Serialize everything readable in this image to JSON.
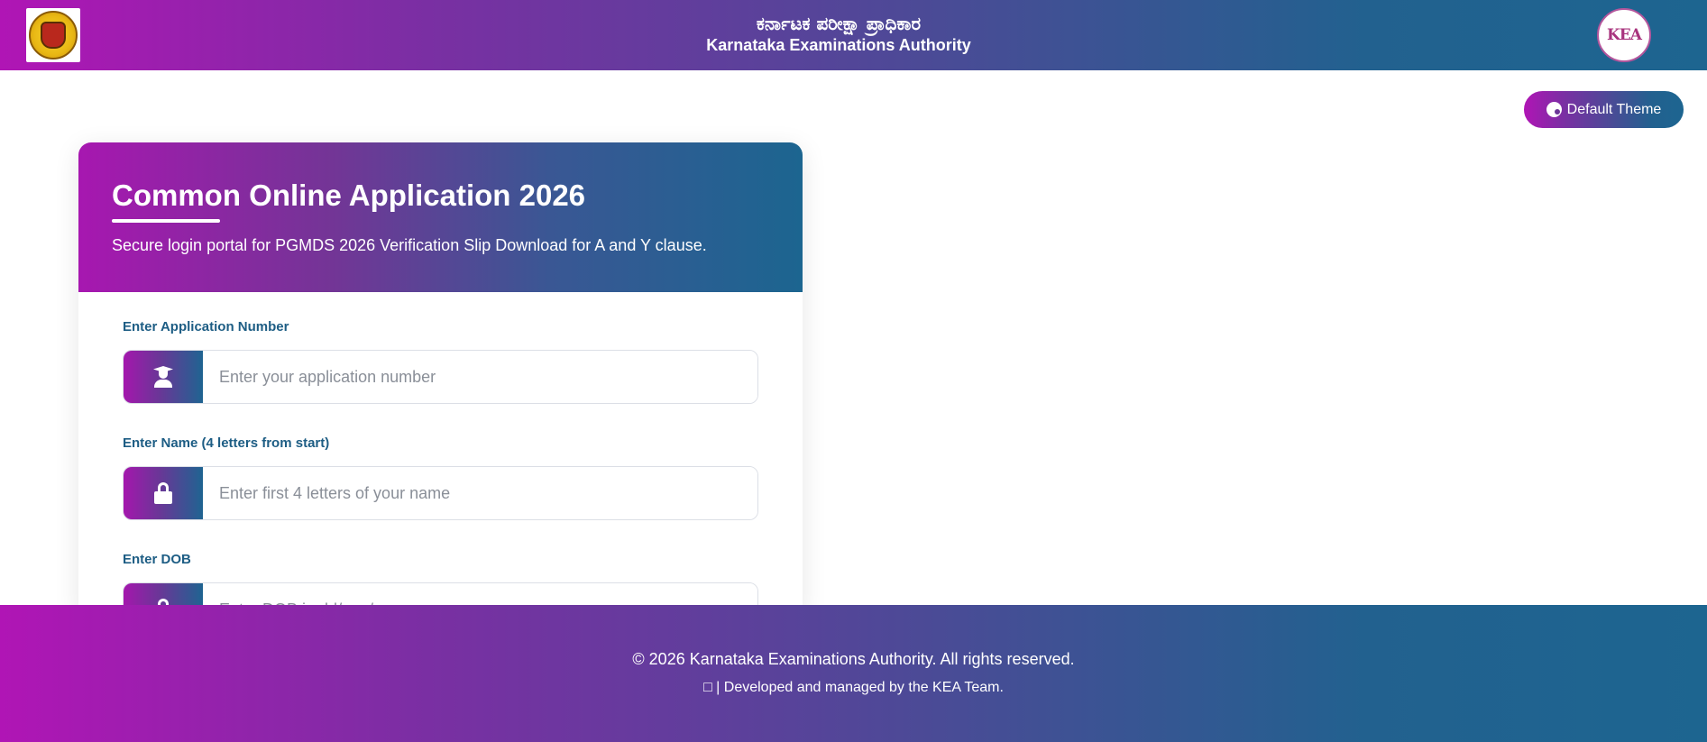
{
  "header": {
    "title_kn": "ಕರ್ನಾಟಕ ಪರೀಕ್ಷಾ ಪ್ರಾಧಿಕಾರ",
    "title_en": "Karnataka Examinations Authority",
    "left_logo": "karnataka-government-emblem",
    "right_logo_text": "KEA"
  },
  "theme_button": {
    "label": "Default Theme",
    "icon": "palette-icon"
  },
  "card": {
    "title": "Common Online Application 2026",
    "subtitle": "Secure login portal for PGMDS 2026 Verification Slip Download for A and Y clause.",
    "fields": [
      {
        "label": "Enter Application Number",
        "placeholder": "Enter your application number",
        "icon": "graduate-icon"
      },
      {
        "label": "Enter Name (4 letters from start)",
        "placeholder": "Enter first 4 letters of your name",
        "icon": "lock-icon"
      },
      {
        "label": "Enter DOB",
        "placeholder": "Enter DOB in dd/mm/yyyy",
        "icon": "lock-icon"
      }
    ]
  },
  "footer": {
    "copyright": "© 2026 Karnataka Examinations Authority. All rights reserved.",
    "developed": "| Developed and managed by the KEA Team."
  },
  "colors": {
    "gradient_start": "#b015b5",
    "gradient_end": "#1d6590",
    "label": "#1d5d84"
  }
}
